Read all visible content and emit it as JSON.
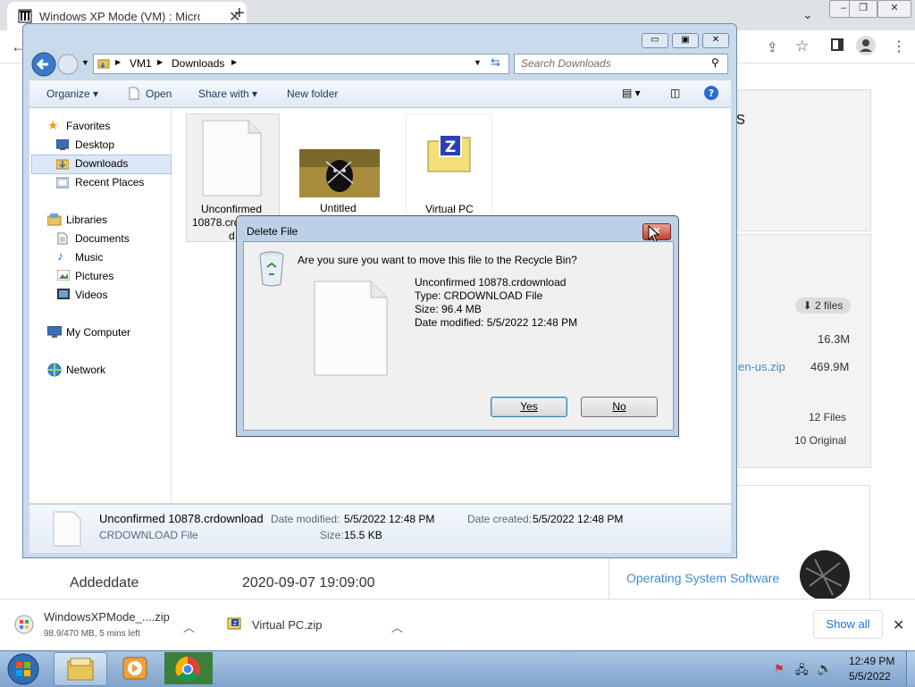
{
  "browser": {
    "tab_title": "Windows XP Mode (VM) : Micros",
    "page": {
      "files_badge": "2 files",
      "size_1": "16.3M",
      "link_zip": "en-us.zip",
      "size_2": "469.9M",
      "files_count": "12 Files",
      "original_count": "10 Original",
      "heading_fragment": "s",
      "meta_key": "Addeddate",
      "meta_value": "2020-09-07 19:09:00",
      "related_link": "Operating System Software"
    },
    "downloads": [
      {
        "name": "WindowsXPMode_....zip",
        "status": "98.9/470 MB, 5 mins left"
      },
      {
        "name": "Virtual PC.zip",
        "status": ""
      }
    ],
    "show_all_label": "Show all"
  },
  "explorer": {
    "breadcrumb": [
      "VM1",
      "Downloads"
    ],
    "search_placeholder": "Search Downloads",
    "commands": {
      "organize": "Organize",
      "open": "Open",
      "share_with": "Share with",
      "new_folder": "New folder"
    },
    "nav": {
      "favorites": "Favorites",
      "favorites_items": [
        "Desktop",
        "Downloads",
        "Recent Places"
      ],
      "libraries": "Libraries",
      "library_items": [
        "Documents",
        "Music",
        "Pictures",
        "Videos"
      ],
      "my_computer": "My Computer",
      "network": "Network"
    },
    "files": [
      {
        "name_line1": "Unconfirmed",
        "name_line2": "10878.crd",
        "name_line3": "d"
      },
      {
        "name_line1": "Untitled"
      },
      {
        "name_line1": "Virtual PC"
      }
    ],
    "details": {
      "file_name": "Unconfirmed 10878.crdownload",
      "file_type": "CRDOWNLOAD File",
      "date_modified_label": "Date modified:",
      "date_modified": "5/5/2022 12:48 PM",
      "size_label": "Size:",
      "size": "15.5 KB",
      "date_created_label": "Date created:",
      "date_created": "5/5/2022 12:48 PM"
    }
  },
  "dialog": {
    "title": "Delete File",
    "question": "Are you sure you want to move this file to the Recycle Bin?",
    "file_name": "Unconfirmed 10878.crdownload",
    "file_type": "Type: CRDOWNLOAD File",
    "file_size": "Size: 96.4 MB",
    "file_date": "Date modified: 5/5/2022 12:48 PM",
    "yes_label": "Yes",
    "no_label": "No"
  },
  "taskbar": {
    "time": "12:49 PM",
    "date": "5/5/2022"
  }
}
